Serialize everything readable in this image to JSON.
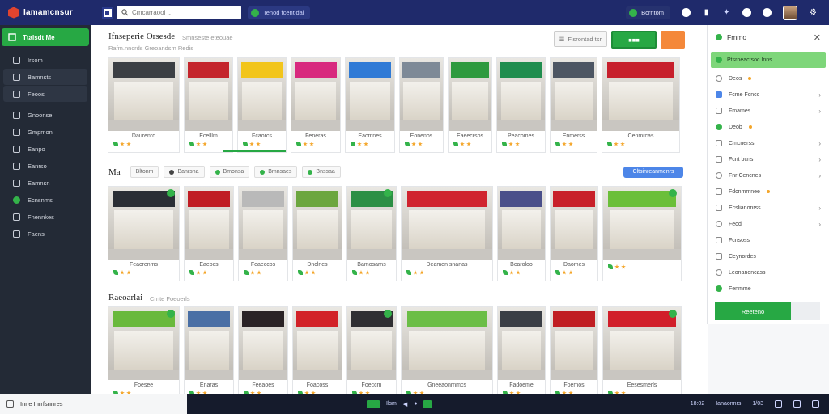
{
  "topbar": {
    "app_name": "Iamamcnsur",
    "search_placeholder": "Cmcarraooi ..",
    "pill_label": "Tenod fcentidal",
    "chip_label": "Bcrntom",
    "icons": [
      "app-icon",
      "search-icon",
      "sparkle-icon",
      "globe-icon",
      "bell-icon",
      "avatar"
    ]
  },
  "sidebar": {
    "header": "Ttalsdt Me",
    "items": [
      {
        "label": "Irsom",
        "active": false
      },
      {
        "label": "Bamnsts",
        "active": true
      },
      {
        "label": "Feoos",
        "active": true
      },
      {
        "label": "Gnoonse",
        "active": false
      },
      {
        "label": "Gmpmon",
        "active": false
      },
      {
        "label": "Eanpo",
        "active": false
      },
      {
        "label": "Eanrso",
        "active": false
      },
      {
        "label": "Eamnsn",
        "active": false
      },
      {
        "label": "Ecnsnms",
        "active": false
      },
      {
        "label": "Fnennkes",
        "active": false
      },
      {
        "label": "Faens",
        "active": false
      }
    ]
  },
  "main": {
    "title": "Ifnseperie Orsesde",
    "subtitle": "Smnseste eteouae",
    "subtitle2": "Rafm.nncrds Greoandsm Redis",
    "tool_btn": "Fisrontad tsr",
    "section2_title": "Ma",
    "filters": [
      "Bltonm",
      "Banrsna",
      "Bmonsa",
      "Bmnsaes",
      "Bnssaa"
    ],
    "filter_button": "Cltsinreanmenrs",
    "section3_title": "Raeoarlai",
    "section3_sub": "Crnte Foeoerls",
    "row1": [
      {
        "caption": "Daurenrd",
        "color": "#3b3f44"
      },
      {
        "caption": "Ecelllm",
        "color": "#c4252c"
      },
      {
        "caption": "Fcaorcs",
        "color": "#f2c51b"
      },
      {
        "caption": "Feneras",
        "color": "#d8297e"
      },
      {
        "caption": "Eacmnes",
        "color": "#2f7ad6"
      },
      {
        "caption": "Eonenos",
        "color": "#7e8a97"
      },
      {
        "caption": "Eaeecrsos",
        "color": "#2e9a3f"
      },
      {
        "caption": "Peacomes",
        "color": "#1f8d4e"
      },
      {
        "caption": "Enmerss",
        "color": "#4d5663"
      },
      {
        "caption": "Cenmrcas",
        "color": "#c7202c"
      }
    ],
    "row2": [
      {
        "caption": "Feacrenms",
        "color": "#2a2e35"
      },
      {
        "caption": "Eaeocs",
        "color": "#c01d24"
      },
      {
        "caption": "Feaeccos",
        "color": "#b9b9b9"
      },
      {
        "caption": "Dnclnes",
        "color": "#6ca63f"
      },
      {
        "caption": "Bamosarns",
        "color": "#2c8f45"
      },
      {
        "caption": "Deamen snanas",
        "color": "#d0242f"
      },
      {
        "caption": "Bcaroloo",
        "color": "#4a4f8a"
      },
      {
        "caption": "Daomes",
        "color": "#c8202a"
      },
      {
        "caption": "",
        "color": "#6bbf3a"
      }
    ],
    "row3": [
      {
        "caption": "Foesee",
        "color": "#69b93c"
      },
      {
        "caption": "Enaras",
        "color": "#4a6fa5"
      },
      {
        "caption": "Feeaoes",
        "color": "#2a2326"
      },
      {
        "caption": "Foacoss",
        "color": "#d22228"
      },
      {
        "caption": "Foeccm",
        "color": "#2f2f33"
      },
      {
        "caption": "Gneeaonrnmcs",
        "color": "#6bbe47"
      },
      {
        "caption": "Fadoeme",
        "color": "#3a3e45"
      },
      {
        "caption": "Foemos",
        "color": "#c01e23"
      },
      {
        "caption": "Eesesmerls",
        "color": "#d11f2a"
      }
    ]
  },
  "panel": {
    "title": "Fmmo",
    "active": "Ptsroeactsoc Inns",
    "items": [
      {
        "label": "Deos",
        "chev": false,
        "dot": true
      },
      {
        "label": "Fcme Fcncc",
        "chev": true,
        "dot": false
      },
      {
        "label": "Fmames",
        "chev": true,
        "dot": false
      },
      {
        "label": "Deob",
        "chev": false,
        "dot": true
      },
      {
        "label": "Cmcnerss",
        "chev": true,
        "dot": false
      },
      {
        "label": "Fcnt bcns",
        "chev": true,
        "dot": false
      },
      {
        "label": "Fnr Cencnes",
        "chev": true,
        "dot": false
      },
      {
        "label": "Fdcnmmnee",
        "chev": false,
        "dot": true
      },
      {
        "label": "Ecslianonrss",
        "chev": true,
        "dot": false
      },
      {
        "label": "Feod",
        "chev": true,
        "dot": false
      },
      {
        "label": "Fcnsoss",
        "chev": false,
        "dot": false
      },
      {
        "label": "Ceynordes",
        "chev": false,
        "dot": false
      },
      {
        "label": "Leonanoncass",
        "chev": false,
        "dot": false
      },
      {
        "label": "Fenmme",
        "chev": false,
        "dot": false
      }
    ],
    "cta": "Reeteno"
  },
  "bottombar": {
    "left_label": "Inne Inrrfsnnres",
    "mid_label": "Ilsm",
    "time": "18:02",
    "right_label": "Ianaonnrs",
    "num": "1/03"
  }
}
